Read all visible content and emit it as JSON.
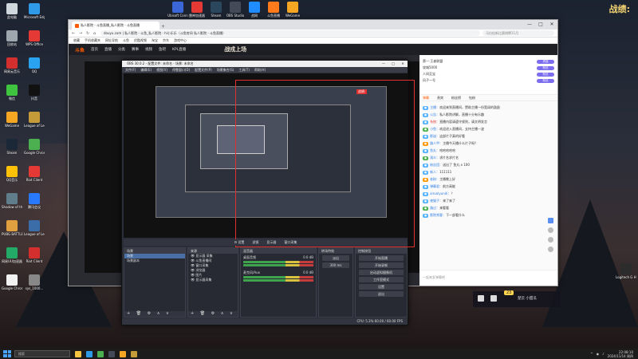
{
  "desktop": {
    "corner_text": "战绩:",
    "left_icons": [
      {
        "label": "此电脑",
        "color": "#cfd8dc"
      },
      {
        "label": "Microsoft Edge",
        "color": "#2f9be8"
      },
      {
        "label": "回收站",
        "color": "#9ea7ad"
      },
      {
        "label": "WPS Office",
        "color": "#e53935"
      },
      {
        "label": "网易云音乐",
        "color": "#d32f2f"
      },
      {
        "label": "QQ",
        "color": "#29a3f0"
      },
      {
        "label": "微信",
        "color": "#3ec43e"
      },
      {
        "label": "抖音",
        "color": "#111111"
      },
      {
        "label": "WeGame",
        "color": "#f5a623"
      },
      {
        "label": "League of Legends",
        "color": "#c59b3a"
      },
      {
        "label": "Steam",
        "color": "#1b2838"
      },
      {
        "label": "Google Chrome",
        "color": "#4caf50"
      },
      {
        "label": "QQ音乐",
        "color": "#ffc107"
      },
      {
        "label": "Riot Client",
        "color": "#e53935"
      },
      {
        "label": "Shadow of the Tomb",
        "color": "#607d8b"
      },
      {
        "label": "腾讯会议",
        "color": "#2979ff"
      },
      {
        "label": "PUBG BATTLEGR...",
        "color": "#e0a040"
      },
      {
        "label": "League of Legends",
        "color": "#3b6ea8"
      },
      {
        "label": "网易UU加速器",
        "color": "#22aa66"
      },
      {
        "label": "Riot Client",
        "color": "#d32f2f"
      },
      {
        "label": "Google Chrome",
        "color": "#f2f2f2"
      },
      {
        "label": "sys_1000...",
        "color": "#888888"
      }
    ],
    "top_icons": [
      {
        "label": "Ubisoft Conn",
        "color": "#3a66d8"
      },
      {
        "label": "雷神加速器",
        "color": "#e53935"
      },
      {
        "label": "Steam",
        "color": "#2a475e"
      },
      {
        "label": "OBS Studio",
        "color": "#444a58"
      },
      {
        "label": "战网",
        "color": "#1f8cff"
      },
      {
        "label": "斗鱼直播",
        "color": "#ff7a1a"
      },
      {
        "label": "WeGame",
        "color": "#f5a623"
      }
    ],
    "right_icons": [
      {
        "label": "Logitech G HUB",
        "color": "#2c2c2c"
      }
    ]
  },
  "browser": {
    "tab_title": "私人影院 - 斗鱼直播_私人影院 - 斗鱼直播",
    "tab_new": "+",
    "window_controls": [
      "—",
      "□",
      "✕"
    ],
    "nav_buttons": [
      "←",
      "→",
      "↻",
      "⌂"
    ],
    "url": "douyu.com | 私人影院 - 斗鱼_私人影院 - hi小乐乐（斗鱼房间 私人影院 - 斗鱼直播）",
    "search_placeholder": "马拉松新比赛棋牌11月",
    "bookmarks": [
      "收藏",
      "手机收藏夹",
      "网址导航",
      "斗鱼",
      "优酷视频",
      "淘宝",
      "京东",
      "游戏中心"
    ],
    "site_nav": [
      "首页",
      "直播",
      "分类",
      "赛事",
      "视频",
      "鱼吧",
      "KPL直播"
    ],
    "site_logo": "斗鱼",
    "site_banner": "战戎上场",
    "chat": {
      "ranks": [
        {
          "name": "第一·王者联盟",
          "badge": "贵族"
        },
        {
          "name": "攻城5000",
          "badge": "粉丝"
        },
        {
          "name": "人间至宝",
          "badge": "粉丝"
        },
        {
          "name": "风子一号",
          "badge": "粉丝"
        }
      ],
      "tabs": [
        "弹幕",
        "贵宾",
        "粉丝榜",
        "钻粉"
      ],
      "messages": [
        {
          "name": "主播",
          "text": "欢迎来到直播间，赞助主播一份宽阔的鼓励",
          "style": ""
        },
        {
          "name": "公告",
          "text": "私人影院讲解，直播十分有乐趣",
          "style": ""
        },
        {
          "name": "系统",
          "text": "直播内容请遵守规则，请文明发言",
          "style": "red"
        },
        {
          "name": "小鱼",
          "text": "欢迎进入直播间，支持主播一波",
          "style": "green"
        },
        {
          "name": "影迷",
          "text": "这部片子真的好看",
          "style": ""
        },
        {
          "name": "路人甲",
          "text": "主播今天播什么片子呀？",
          "style": "orange"
        },
        {
          "name": "鱼丸",
          "text": "哈哈哈哈哈",
          "style": ""
        },
        {
          "name": "观众",
          "text": "求片名求片名",
          "style": "green"
        },
        {
          "name": "粉丝团",
          "text": "送出了 鱼丸 x 100",
          "style": ""
        },
        {
          "name": "新人",
          "text": "111111",
          "style": ""
        },
        {
          "name": "老粉",
          "text": "主播晚上好",
          "style": "orange"
        },
        {
          "name": "弹幕君",
          "text": "前方高能",
          "style": ""
        },
        {
          "name": "airuolyundi",
          "text": "？",
          "style": ""
        },
        {
          "name": "夜猫子",
          "text": "来了来了",
          "style": ""
        },
        {
          "name": "路过",
          "text": "来看看",
          "style": "green"
        },
        {
          "name": "影院常客",
          "text": "下一部看什么",
          "style": ""
        }
      ],
      "input_placeholder": "一起来发弹幕吧"
    }
  },
  "obs": {
    "title": "OBS 30.0.2 - 配置文件: 未命名 - 场景: 未命名",
    "window_controls": [
      "—",
      "□",
      "✕"
    ],
    "menu": [
      "文件(F)",
      "编辑(E)",
      "视图(V)",
      "停靠窗口(D)",
      "配置文件(P)",
      "场景集合(S)",
      "工具(T)",
      "帮助(H)"
    ],
    "preview_tag": "战绩:",
    "controls_bar": [
      "⚙ 设置",
      "滤镜",
      "显示器",
      "窗口采集"
    ],
    "docks": {
      "scenes": {
        "title": "场景",
        "items": [
          "场景",
          "场景副本"
        ],
        "footer": "+ 🗑 ⚙ ∧ ∨"
      },
      "sources": {
        "title": "来源",
        "items": [
          "显示器 采集",
          "斗鱼直播间",
          "窗口采集",
          "浏览器",
          "图片",
          "显示器采集"
        ],
        "footer": "+ 🗑 ⚙ ∧ ∨"
      },
      "mixer": {
        "title": "混音器",
        "rows": [
          {
            "label": "桌面音频",
            "value": "0.0 dB"
          },
          {
            "label": "麦克风/Aux",
            "value": "0.0 dB"
          }
        ]
      },
      "transitions": {
        "title": "转场特效",
        "items": [
          "淡出",
          "300 ms"
        ]
      },
      "controls": {
        "title": "控制按钮",
        "buttons": [
          "开始直播",
          "开始录制",
          "启动虚拟摄像机",
          "工作室模式",
          "设置",
          "退出"
        ]
      }
    },
    "status": "CPU: 5.3%   60.00 / 60.00 FPS"
  },
  "floating": {
    "badge": "23",
    "label": "楚云 小甜瓜"
  },
  "taskbar": {
    "search_placeholder": "搜索",
    "apps": [
      {
        "name": "file-explorer",
        "color": "#f5c542"
      },
      {
        "name": "edge",
        "color": "#2f9be8"
      },
      {
        "name": "chrome",
        "color": "#4caf50"
      },
      {
        "name": "obs",
        "color": "#444a58"
      },
      {
        "name": "wegame",
        "color": "#f5a623"
      },
      {
        "name": "league",
        "color": "#c59b3a"
      }
    ],
    "time": "22:08:10",
    "date": "2024/11/14 周四"
  }
}
